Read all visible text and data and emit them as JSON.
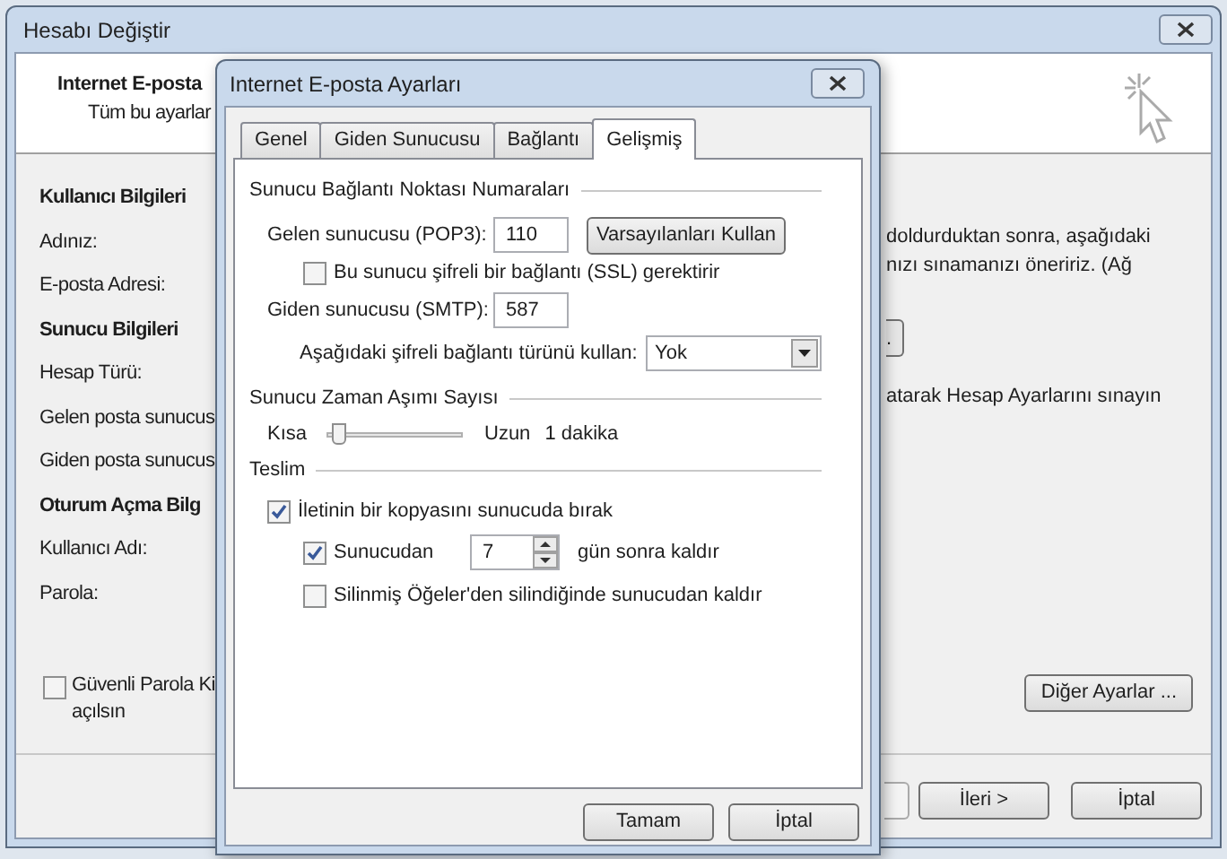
{
  "window": {
    "title": "Hesabı Değiştir"
  },
  "header": {
    "title": "Internet E-posta",
    "subtitle": "Tüm bu ayarlar"
  },
  "left_sections": [
    {
      "heading": "Kullanıcı Bilgileri",
      "fields": [
        "Adınız:",
        "E-posta Adresi:"
      ]
    },
    {
      "heading": "Sunucu Bilgileri",
      "fields": [
        "Hesap Türü:",
        "Gelen posta sunucus",
        "Giden posta sunucus"
      ]
    },
    {
      "heading": "Oturum Açma Bilg",
      "fields": [
        "Kullanıcı Adı:",
        "Parola:"
      ]
    }
  ],
  "spa_checkbox": {
    "lines": [
      "Güvenli Parola Ki",
      "açılsın"
    ],
    "checked": false
  },
  "right_texts": [
    "doldurduktan sonra, aşağıdaki",
    "nızı sınamanızı öneririz. (Ağ"
  ],
  "partial_button": ".",
  "test_text": "atarak Hesap Ayarlarını sınayın",
  "more_settings_button": "Diğer Ayarlar ...",
  "footer_buttons": [
    "İleri >",
    "İptal"
  ],
  "dialog": {
    "title": "Internet E-posta Ayarları",
    "tabs": [
      {
        "label": "Genel",
        "selected": false
      },
      {
        "label": "Giden Sunucusu",
        "selected": false
      },
      {
        "label": "Bağlantı",
        "selected": false
      },
      {
        "label": "Gelişmiş",
        "selected": true
      }
    ],
    "ports": {
      "heading": "Sunucu Bağlantı Noktası Numaraları",
      "incoming_label": "Gelen sunucusu (POP3):",
      "incoming_value": "110",
      "defaults_button": "Varsayılanları Kullan",
      "ssl_label": "Bu sunucu şifreli bir bağlantı (SSL) gerektirir",
      "ssl_checked": false,
      "outgoing_label": "Giden sunucusu (SMTP):",
      "outgoing_value": "587",
      "encryption_label": "Aşağıdaki şifreli bağlantı türünü kullan:",
      "encryption_value": "Yok"
    },
    "timeout": {
      "heading": "Sunucu Zaman Aşımı Sayısı",
      "min_label": "Kısa",
      "max_label": "Uzun",
      "level": 0.05,
      "value": "1 dakika"
    },
    "delivery": {
      "heading": "Teslim",
      "leave_copy_label": "İletinin bir kopyasını sunucuda bırak",
      "leave_copy_checked": true,
      "remove_after_label": "Sunucudan",
      "remove_after_checked": true,
      "days": "7",
      "days_suffix": "gün sonra kaldır",
      "remove_deleted_label": "Silinmiş Öğeler'den silindiğinde sunucudan kaldır",
      "remove_deleted_checked": false
    },
    "buttons": [
      "Tamam",
      "İptal"
    ]
  }
}
